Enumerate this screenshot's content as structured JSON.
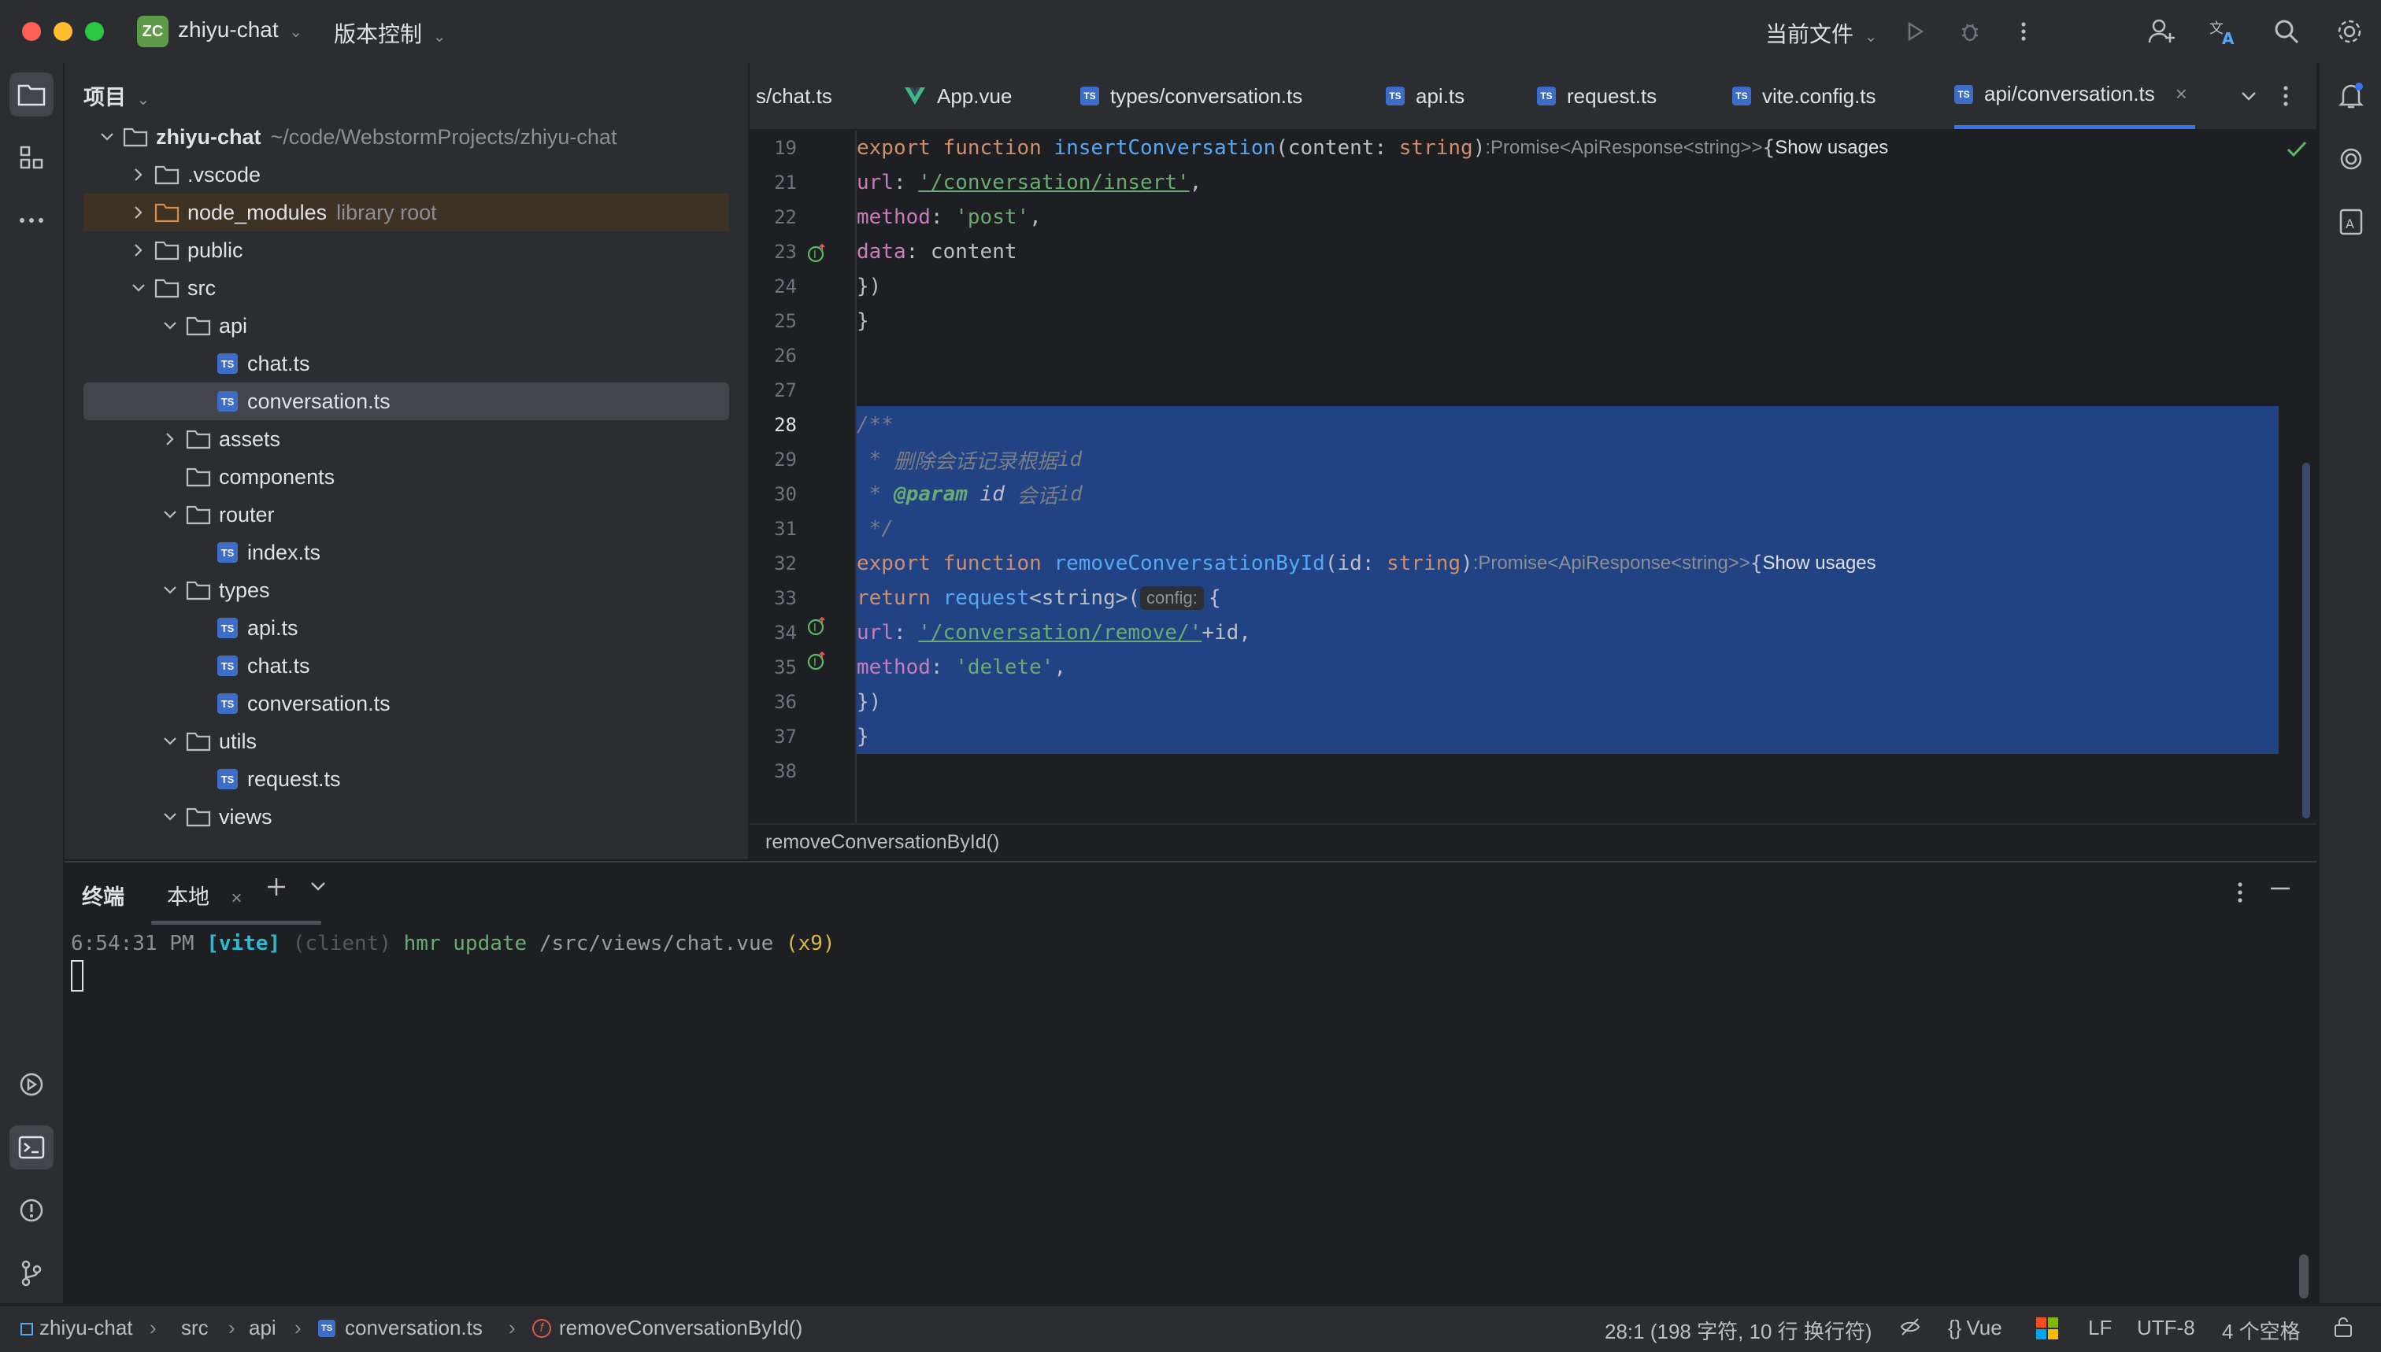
{
  "titlebar": {
    "project_badge": "ZC",
    "project_name": "zhiyu-chat",
    "vcs_menu": "版本控制",
    "run_config": "当前文件"
  },
  "project_panel": {
    "title": "项目",
    "root_name": "zhiyu-chat",
    "root_path": "~/code/WebstormProjects/zhiyu-chat",
    "items": [
      {
        "label": "zhiyu-chat",
        "hint": "~/code/WebstormProjects/zhiyu-chat"
      },
      {
        "label": ".vscode"
      },
      {
        "label": "node_modules",
        "hint": "library root"
      },
      {
        "label": "public"
      },
      {
        "label": "src"
      },
      {
        "label": "api"
      },
      {
        "label": "chat.ts"
      },
      {
        "label": "conversation.ts"
      },
      {
        "label": "assets"
      },
      {
        "label": "components"
      },
      {
        "label": "router"
      },
      {
        "label": "index.ts"
      },
      {
        "label": "types"
      },
      {
        "label": "api.ts"
      },
      {
        "label": "chat.ts"
      },
      {
        "label": "conversation.ts"
      },
      {
        "label": "utils"
      },
      {
        "label": "request.ts"
      },
      {
        "label": "views"
      }
    ]
  },
  "tabs": [
    {
      "label": "s/chat.ts"
    },
    {
      "label": "App.vue"
    },
    {
      "label": "types/conversation.ts"
    },
    {
      "label": "api.ts"
    },
    {
      "label": "request.ts"
    },
    {
      "label": "vite.config.ts"
    },
    {
      "label": "api/conversation.ts"
    }
  ],
  "editor": {
    "line_numbers": [
      "19",
      "21",
      "22",
      "23",
      "24",
      "25",
      "26",
      "27",
      "28",
      "29",
      "30",
      "31",
      "32",
      "33",
      "34",
      "35",
      "36",
      "37",
      "38"
    ],
    "current_line": "28",
    "hint_promise_1": ":Promise<ApiResponse<string>>",
    "hint_promise_2": ":Promise<ApiResponse<string>>",
    "show_usages": "Show usages",
    "hint_config": "config:",
    "code": {
      "l19_kw": "export function ",
      "l19_fn": "insertConversation",
      "l19_params": "(content: ",
      "l19_type": "string",
      "l19_close": ")",
      "l21_prop": "url",
      "l21_str": "'/conversation/insert'",
      "l22_prop": "method",
      "l22_str": "'post'",
      "l23_prop": "data",
      "l23_val": ": content",
      "l24": "})",
      "l25": "}",
      "l28": "/**",
      "l29_star": " * ",
      "l29_text": "删除会话记录根据",
      "l29_id": "id",
      "l30_star": " * ",
      "l30_tag": "@param",
      "l30_name": " id ",
      "l30_text": "会话",
      "l30_id": "id",
      "l31": " */",
      "l32_kw": "export function ",
      "l32_fn": "removeConversationById",
      "l32_params": "(id: ",
      "l32_type": "string",
      "l32_close": ")",
      "l33_kw": "return ",
      "l33_fn": "request",
      "l33_gen": "<string>(",
      "l33_brace": "{",
      "l34_prop": "url",
      "l34_str": "'/conversation/remove/'",
      "l34_rest": "+id,",
      "l35_prop": "method",
      "l35_str": "'delete'",
      "l36": "})",
      "l37": "}"
    },
    "breadcrumb": "removeConversationById()"
  },
  "terminal": {
    "title": "终端",
    "tab_local": "本地",
    "line_time": "6:54:31 PM ",
    "line_vite": "[vite]",
    "line_client": " (client) ",
    "line_msg": "hmr update ",
    "line_path": "/src/views/chat.vue ",
    "line_count": "(x9)"
  },
  "statusbar": {
    "crumbs": [
      "zhiyu-chat",
      "src",
      "api",
      "conversation.ts",
      "removeConversationById()"
    ],
    "position": "28:1 (198 字符, 10 行 换行符)",
    "language": "Vue",
    "line_sep": "LF",
    "encoding": "UTF-8",
    "indent": "4 个空格"
  },
  "colors": {
    "accent": "#3574f0",
    "selection": "#214283",
    "project_badge": "#5d9b47"
  }
}
